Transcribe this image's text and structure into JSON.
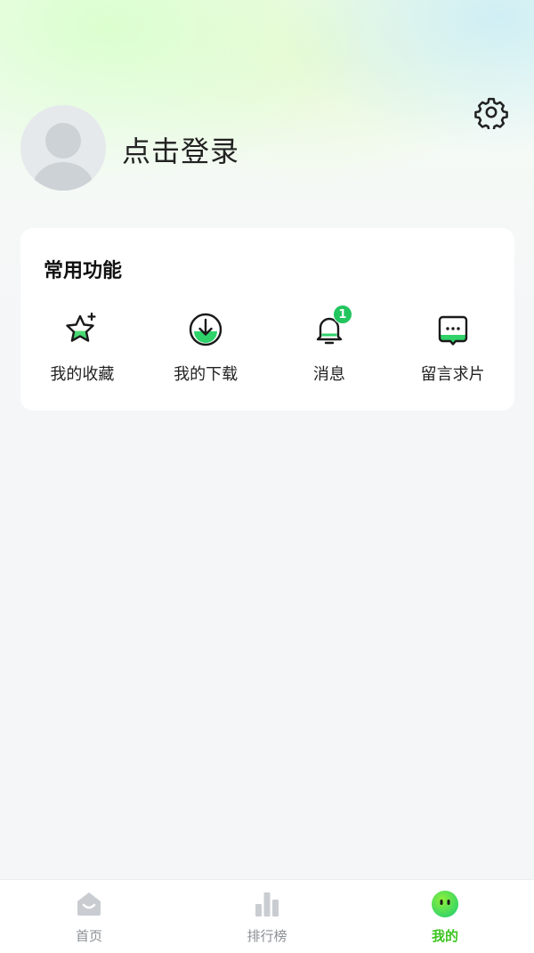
{
  "header": {
    "login_text": "点击登录"
  },
  "card": {
    "title": "常用功能",
    "items": [
      {
        "label": "我的收藏",
        "icon": "star-sparkle-icon"
      },
      {
        "label": "我的下载",
        "icon": "download-icon"
      },
      {
        "label": "消息",
        "icon": "bell-icon",
        "badge": "1"
      },
      {
        "label": "留言求片",
        "icon": "chat-bubble-icon"
      }
    ]
  },
  "tabbar": {
    "tabs": [
      {
        "label": "首页",
        "icon": "home-icon",
        "active": false
      },
      {
        "label": "排行榜",
        "icon": "bar-chart-icon",
        "active": false
      },
      {
        "label": "我的",
        "icon": "smiley-face-icon",
        "active": true
      }
    ]
  },
  "colors": {
    "accent": "#3cc51f",
    "badge": "#22c55e",
    "background": "#f5f6f8",
    "inactive_tab": "#8b8f94"
  }
}
